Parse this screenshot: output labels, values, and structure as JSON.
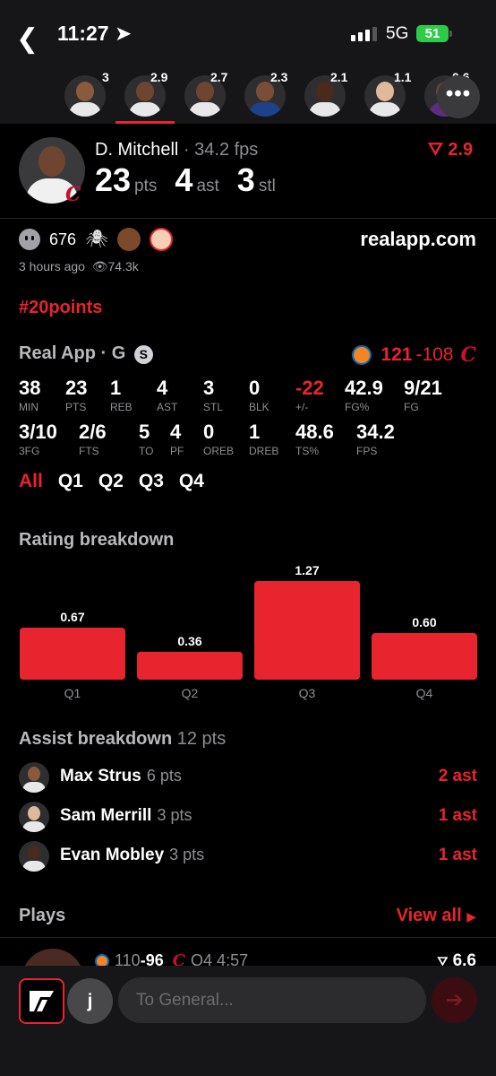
{
  "status_bar": {
    "time": "11:27",
    "network": "5G",
    "battery": "51"
  },
  "player_strip": {
    "players": [
      {
        "rating": "3"
      },
      {
        "rating": "2.9"
      },
      {
        "rating": "2.7"
      },
      {
        "rating": "2.3"
      },
      {
        "rating": "2.1"
      },
      {
        "rating": "1.1"
      },
      {
        "rating": "0.6"
      }
    ]
  },
  "player": {
    "name": "D. Mitchell",
    "fps_text": "· 34.2 fps",
    "pts": "23",
    "pts_label": "pts",
    "ast": "4",
    "ast_label": "ast",
    "stl": "3",
    "stl_label": "stl",
    "rating": "2.9"
  },
  "reactions": {
    "count": "676",
    "brand": "realapp.com",
    "time_ago": "3 hours ago",
    "views": "74.3k"
  },
  "hashtag": "#20points",
  "game": {
    "title": "Real App · G",
    "badge": "S",
    "score_home": "121",
    "score_sep": "-108"
  },
  "stats": [
    {
      "value": "38",
      "label": "MIN"
    },
    {
      "value": "23",
      "label": "PTS"
    },
    {
      "value": "1",
      "label": "REB"
    },
    {
      "value": "4",
      "label": "AST"
    },
    {
      "value": "3",
      "label": "STL"
    },
    {
      "value": "0",
      "label": "BLK"
    },
    {
      "value": "-22",
      "label": "+/-"
    },
    {
      "value": "42.9",
      "label": "FG%"
    },
    {
      "value": "9/21",
      "label": "FG"
    },
    {
      "value": "3/10",
      "label": "3FG"
    },
    {
      "value": "2/6",
      "label": "FTS"
    },
    {
      "value": "5",
      "label": "TO"
    },
    {
      "value": "4",
      "label": "PF"
    },
    {
      "value": "0",
      "label": "OREB"
    },
    {
      "value": "1",
      "label": "DREB"
    },
    {
      "value": "48.6",
      "label": "TS%"
    },
    {
      "value": "34.2",
      "label": "FPS"
    }
  ],
  "quarters": [
    "All",
    "Q1",
    "Q2",
    "Q3",
    "Q4"
  ],
  "rating_breakdown": {
    "title": "Rating breakdown"
  },
  "chart_data": {
    "type": "bar",
    "categories": [
      "Q1",
      "Q2",
      "Q3",
      "Q4"
    ],
    "values": [
      0.67,
      0.36,
      1.27,
      0.6
    ],
    "value_labels": [
      "0.67",
      "0.36",
      "1.27",
      "0.60"
    ],
    "ylim": [
      0,
      1.27
    ],
    "color": "#e8242e"
  },
  "assist_breakdown": {
    "title": "Assist breakdown",
    "total": "12 pts",
    "rows": [
      {
        "name": "Max Strus",
        "pts": "6 pts",
        "ast": "2 ast"
      },
      {
        "name": "Sam Merrill",
        "pts": "3 pts",
        "ast": "1 ast"
      },
      {
        "name": "Evan Mobley",
        "pts": "3 pts",
        "ast": "1 ast"
      }
    ]
  },
  "plays": {
    "title": "Plays",
    "view_all": "View all",
    "first": {
      "score_a": "110",
      "score_b": "-96",
      "clock": "Q4 4:57",
      "rating": "6.6"
    }
  },
  "composer": {
    "avatar_letter": "j",
    "placeholder": "To General..."
  },
  "colors": {
    "accent": "#e8242e",
    "background": "#000000",
    "panel": "#161618"
  }
}
